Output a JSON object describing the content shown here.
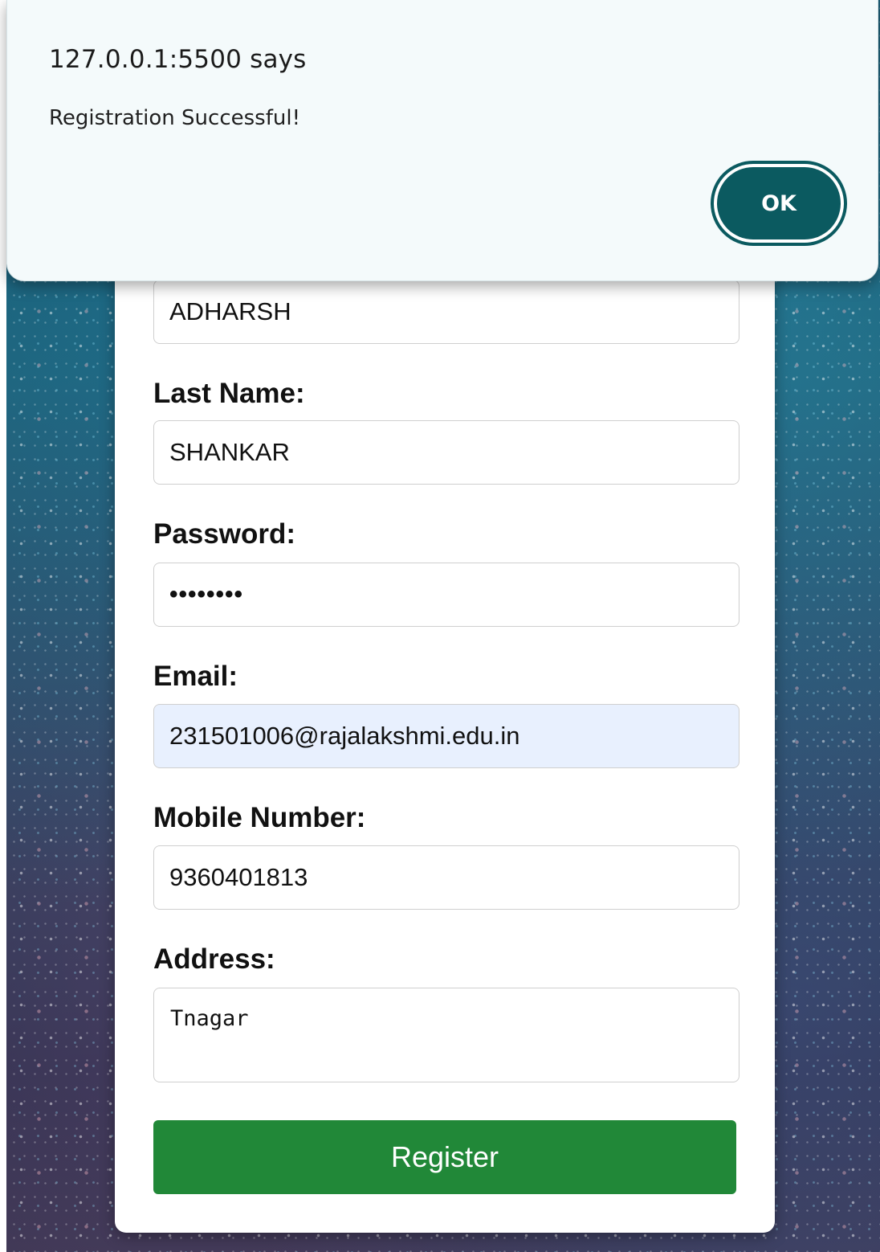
{
  "dialog": {
    "title": "127.0.0.1:5500 says",
    "message": "Registration Successful!",
    "ok_label": "OK"
  },
  "form": {
    "first_name_value": "ADHARSH",
    "last_name_label": "Last Name:",
    "last_name_value": "SHANKAR",
    "password_label": "Password:",
    "password_value": "••••••••",
    "email_label": "Email:",
    "email_value": "231501006@rajalakshmi.edu.in",
    "mobile_label": "Mobile Number:",
    "mobile_value": "9360401813",
    "address_label": "Address:",
    "address_value": "Tnagar",
    "register_label": "Register"
  },
  "colors": {
    "register_button": "#218838",
    "dialog_button": "#0b5a60",
    "autofill_background": "#e8f0fe"
  }
}
